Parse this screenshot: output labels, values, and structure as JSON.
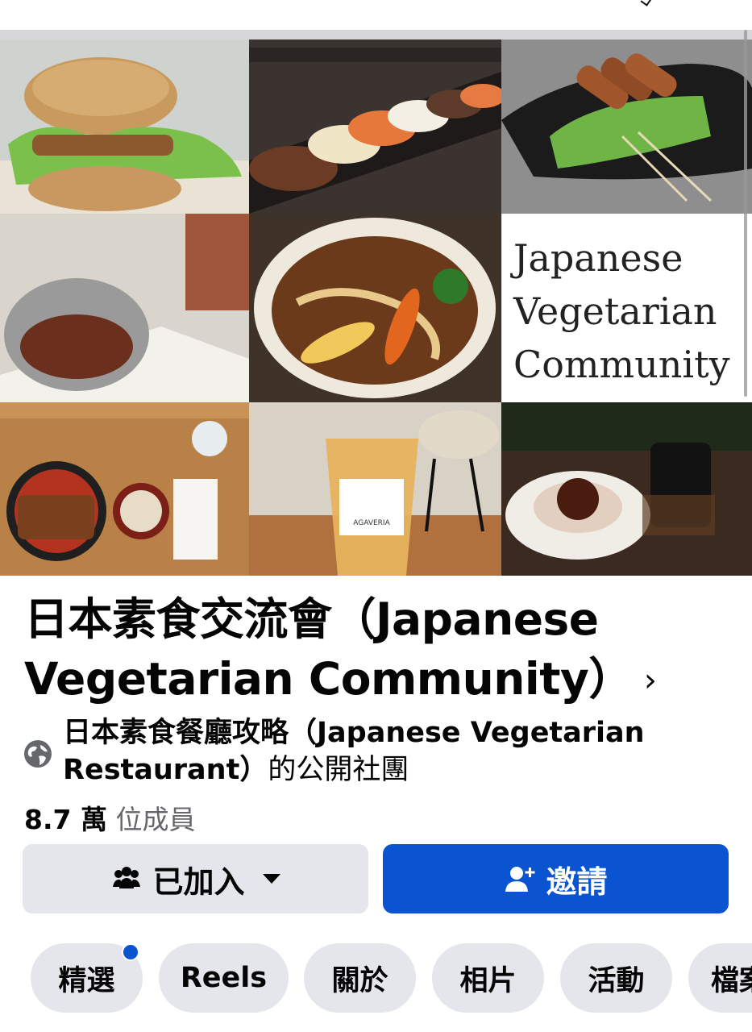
{
  "group": {
    "title": "日本素食交流會（Japanese Vegetarian Community）",
    "chevron": "›",
    "parent_page_name": "日本素食餐廳攻略（Japanese Vegetarian Restaurant）",
    "visibility_suffix": "的公開社團",
    "member_count": "8.7 萬",
    "member_label": "位成員"
  },
  "cover": {
    "logo_text": "Japanese\nVegetarian\nCommunity",
    "cup_label": "AGAVERIA"
  },
  "actions": {
    "joined_label": "已加入",
    "invite_label": "邀請"
  },
  "tabs": [
    {
      "label": "精選",
      "has_notification": true
    },
    {
      "label": "Reels"
    },
    {
      "label": "關於"
    },
    {
      "label": "相片"
    },
    {
      "label": "活動"
    },
    {
      "label": "檔案"
    }
  ],
  "colors": {
    "primary": "#0a54d1",
    "button_grey": "#e4e6eb",
    "secondary_text": "#65676b"
  }
}
